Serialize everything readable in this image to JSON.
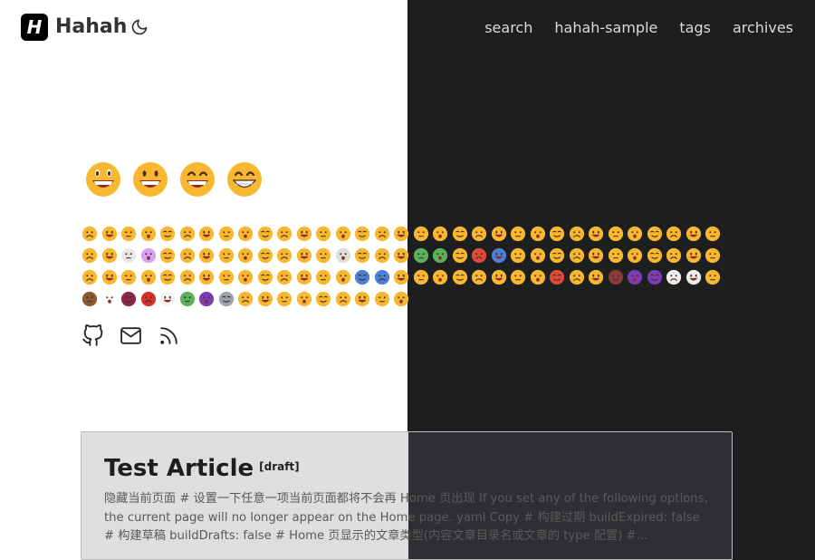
{
  "header": {
    "logo_letter": "H",
    "brand": "Hahah",
    "nav": [
      "search",
      "hahah-sample",
      "tags",
      "archives"
    ]
  },
  "emoji_icons": {
    "big_row": [
      "grinning-face-big-eyes",
      "grinning-face",
      "grinning-face-smiling-eyes",
      "beaming-face"
    ],
    "rows_count": 4
  },
  "social": {
    "icons": [
      "github-icon",
      "email-icon",
      "rss-icon"
    ]
  },
  "post": {
    "title": "Test Article",
    "badge": "[draft]",
    "excerpt": "隐藏当前页面 # 设置一下任意一项当前页面都将不会再 Home 页出现 If you set any of the following options, the current page will no longer appear on the Home page. yaml Copy # 构建过期 buildExpired: false # 构建草稿 buildDrafts: false # Home 页显示的文章类型(内容文章目录名或文章的 type 配置) #..."
  },
  "colors": {
    "left_bg": "#ffffff",
    "right_bg": "#1d1e20",
    "emoji_yellow": "#f7b731",
    "card_light": "#dedede",
    "card_dark": "#2e2e33"
  }
}
